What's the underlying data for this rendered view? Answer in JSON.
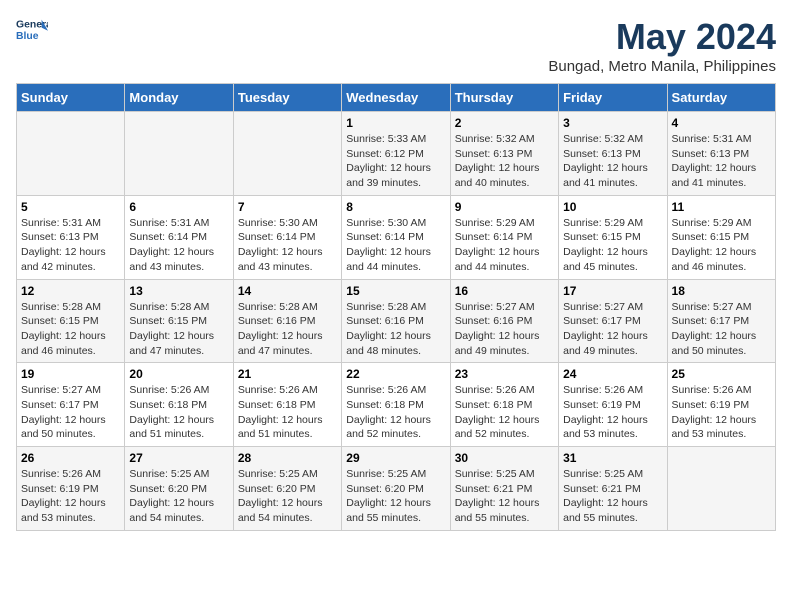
{
  "logo": {
    "line1": "General",
    "line2": "Blue"
  },
  "title": "May 2024",
  "subtitle": "Bungad, Metro Manila, Philippines",
  "days_header": [
    "Sunday",
    "Monday",
    "Tuesday",
    "Wednesday",
    "Thursday",
    "Friday",
    "Saturday"
  ],
  "weeks": [
    [
      {
        "num": "",
        "info": ""
      },
      {
        "num": "",
        "info": ""
      },
      {
        "num": "",
        "info": ""
      },
      {
        "num": "1",
        "info": "Sunrise: 5:33 AM\nSunset: 6:12 PM\nDaylight: 12 hours\nand 39 minutes."
      },
      {
        "num": "2",
        "info": "Sunrise: 5:32 AM\nSunset: 6:13 PM\nDaylight: 12 hours\nand 40 minutes."
      },
      {
        "num": "3",
        "info": "Sunrise: 5:32 AM\nSunset: 6:13 PM\nDaylight: 12 hours\nand 41 minutes."
      },
      {
        "num": "4",
        "info": "Sunrise: 5:31 AM\nSunset: 6:13 PM\nDaylight: 12 hours\nand 41 minutes."
      }
    ],
    [
      {
        "num": "5",
        "info": "Sunrise: 5:31 AM\nSunset: 6:13 PM\nDaylight: 12 hours\nand 42 minutes."
      },
      {
        "num": "6",
        "info": "Sunrise: 5:31 AM\nSunset: 6:14 PM\nDaylight: 12 hours\nand 43 minutes."
      },
      {
        "num": "7",
        "info": "Sunrise: 5:30 AM\nSunset: 6:14 PM\nDaylight: 12 hours\nand 43 minutes."
      },
      {
        "num": "8",
        "info": "Sunrise: 5:30 AM\nSunset: 6:14 PM\nDaylight: 12 hours\nand 44 minutes."
      },
      {
        "num": "9",
        "info": "Sunrise: 5:29 AM\nSunset: 6:14 PM\nDaylight: 12 hours\nand 44 minutes."
      },
      {
        "num": "10",
        "info": "Sunrise: 5:29 AM\nSunset: 6:15 PM\nDaylight: 12 hours\nand 45 minutes."
      },
      {
        "num": "11",
        "info": "Sunrise: 5:29 AM\nSunset: 6:15 PM\nDaylight: 12 hours\nand 46 minutes."
      }
    ],
    [
      {
        "num": "12",
        "info": "Sunrise: 5:28 AM\nSunset: 6:15 PM\nDaylight: 12 hours\nand 46 minutes."
      },
      {
        "num": "13",
        "info": "Sunrise: 5:28 AM\nSunset: 6:15 PM\nDaylight: 12 hours\nand 47 minutes."
      },
      {
        "num": "14",
        "info": "Sunrise: 5:28 AM\nSunset: 6:16 PM\nDaylight: 12 hours\nand 47 minutes."
      },
      {
        "num": "15",
        "info": "Sunrise: 5:28 AM\nSunset: 6:16 PM\nDaylight: 12 hours\nand 48 minutes."
      },
      {
        "num": "16",
        "info": "Sunrise: 5:27 AM\nSunset: 6:16 PM\nDaylight: 12 hours\nand 49 minutes."
      },
      {
        "num": "17",
        "info": "Sunrise: 5:27 AM\nSunset: 6:17 PM\nDaylight: 12 hours\nand 49 minutes."
      },
      {
        "num": "18",
        "info": "Sunrise: 5:27 AM\nSunset: 6:17 PM\nDaylight: 12 hours\nand 50 minutes."
      }
    ],
    [
      {
        "num": "19",
        "info": "Sunrise: 5:27 AM\nSunset: 6:17 PM\nDaylight: 12 hours\nand 50 minutes."
      },
      {
        "num": "20",
        "info": "Sunrise: 5:26 AM\nSunset: 6:18 PM\nDaylight: 12 hours\nand 51 minutes."
      },
      {
        "num": "21",
        "info": "Sunrise: 5:26 AM\nSunset: 6:18 PM\nDaylight: 12 hours\nand 51 minutes."
      },
      {
        "num": "22",
        "info": "Sunrise: 5:26 AM\nSunset: 6:18 PM\nDaylight: 12 hours\nand 52 minutes."
      },
      {
        "num": "23",
        "info": "Sunrise: 5:26 AM\nSunset: 6:18 PM\nDaylight: 12 hours\nand 52 minutes."
      },
      {
        "num": "24",
        "info": "Sunrise: 5:26 AM\nSunset: 6:19 PM\nDaylight: 12 hours\nand 53 minutes."
      },
      {
        "num": "25",
        "info": "Sunrise: 5:26 AM\nSunset: 6:19 PM\nDaylight: 12 hours\nand 53 minutes."
      }
    ],
    [
      {
        "num": "26",
        "info": "Sunrise: 5:26 AM\nSunset: 6:19 PM\nDaylight: 12 hours\nand 53 minutes."
      },
      {
        "num": "27",
        "info": "Sunrise: 5:25 AM\nSunset: 6:20 PM\nDaylight: 12 hours\nand 54 minutes."
      },
      {
        "num": "28",
        "info": "Sunrise: 5:25 AM\nSunset: 6:20 PM\nDaylight: 12 hours\nand 54 minutes."
      },
      {
        "num": "29",
        "info": "Sunrise: 5:25 AM\nSunset: 6:20 PM\nDaylight: 12 hours\nand 55 minutes."
      },
      {
        "num": "30",
        "info": "Sunrise: 5:25 AM\nSunset: 6:21 PM\nDaylight: 12 hours\nand 55 minutes."
      },
      {
        "num": "31",
        "info": "Sunrise: 5:25 AM\nSunset: 6:21 PM\nDaylight: 12 hours\nand 55 minutes."
      },
      {
        "num": "",
        "info": ""
      }
    ]
  ]
}
